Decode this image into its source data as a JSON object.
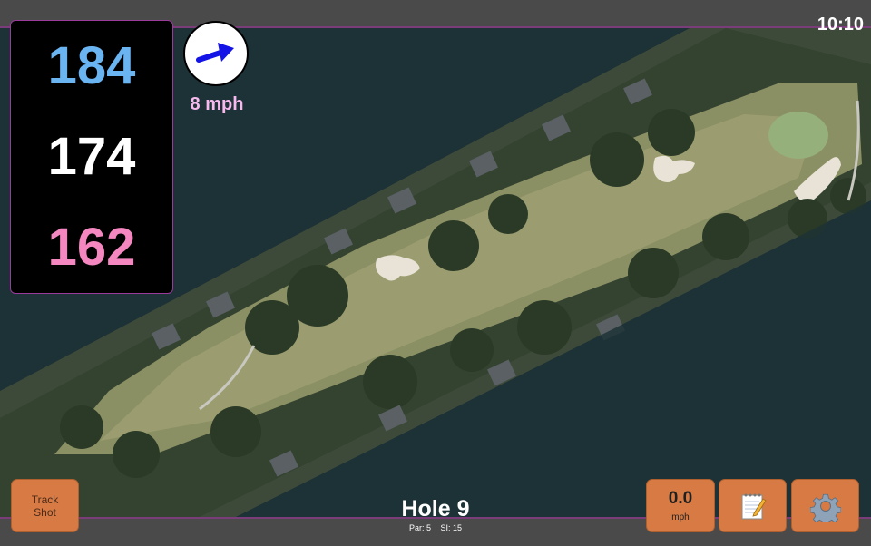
{
  "status": {
    "time": "10:10"
  },
  "distances": {
    "back": "184",
    "middle": "174",
    "front": "162"
  },
  "wind": {
    "speed_label": "8 mph",
    "icon": "wind-direction-arrow-icon"
  },
  "buttons": {
    "track_shot_line1": "Track",
    "track_shot_line2": "Shot",
    "speed_value": "0.0",
    "speed_unit": "mph",
    "notes_icon": "notepad-icon",
    "settings_icon": "gear-icon"
  },
  "hole": {
    "title": "Hole 9",
    "par": "Par: 5",
    "stroke_index": "SI: 15"
  },
  "colors": {
    "back_distance": "#6ab4f2",
    "middle_distance": "#ffffff",
    "front_distance": "#f487c0",
    "button": "#d77a43",
    "accent_border": "#9a3a9a"
  }
}
